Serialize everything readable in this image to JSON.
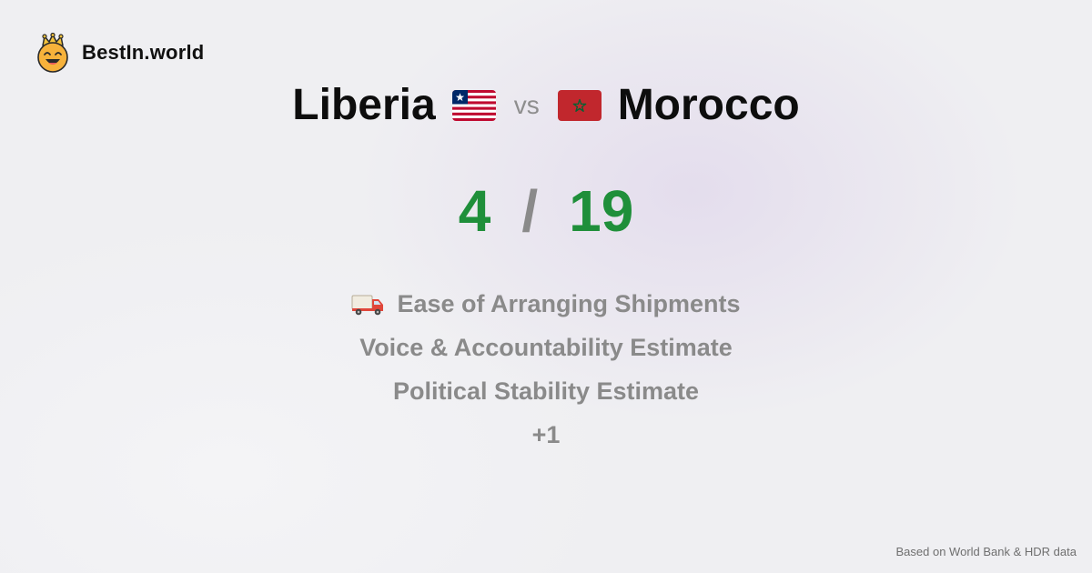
{
  "brand": {
    "name": "BestIn.world",
    "logo_icon": "crowned-smiley-icon"
  },
  "comparison": {
    "left_country": "Liberia",
    "left_flag_icon": "liberia-flag-icon",
    "vs_label": "vs",
    "right_country": "Morocco",
    "right_flag_icon": "morocco-flag-icon"
  },
  "score": {
    "left": "4",
    "separator": "/",
    "right": "19",
    "color": "#1f8f3a"
  },
  "metrics": {
    "items": [
      {
        "label": "Ease of Arranging Shipments",
        "icon": "delivery-truck-icon"
      },
      {
        "label": "Voice & Accountability Estimate"
      },
      {
        "label": "Political Stability Estimate"
      }
    ],
    "more_label": "+1"
  },
  "footer": {
    "source_note": "Based on World Bank & HDR data"
  },
  "colors": {
    "score_green": "#1f8f3a",
    "muted_gray": "#8a8a8a",
    "liberia_red": "#bf0a30",
    "liberia_blue": "#002868",
    "morocco_red": "#c1272d",
    "morocco_green": "#006233"
  }
}
